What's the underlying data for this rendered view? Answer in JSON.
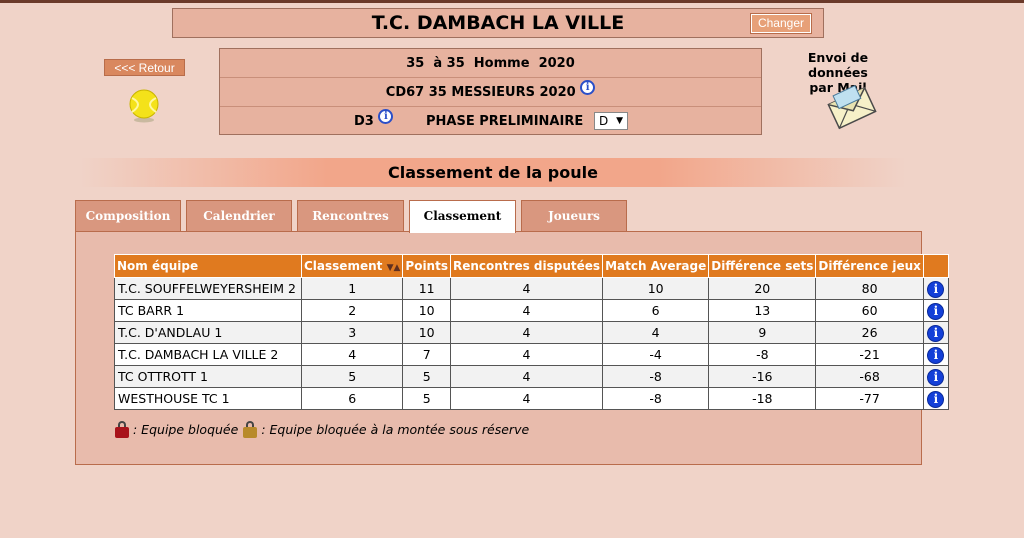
{
  "header": {
    "title": "T.C. DAMBACH LA VILLE",
    "change_label": "Changer",
    "back_label": "<<< Retour"
  },
  "info": {
    "row1": "35  à 35  Homme  2020",
    "row2": "CD67 35 MESSIEURS 2020",
    "division": "D3",
    "phase": "PHASE PRELIMINAIRE",
    "select_value": "D"
  },
  "mail": {
    "label_line1": "Envoi de données",
    "label_line2": "par Mail"
  },
  "section_title": "Classement de la poule",
  "tabs": [
    {
      "label": "Composition",
      "active": false
    },
    {
      "label": "Calendrier",
      "active": false
    },
    {
      "label": "Rencontres",
      "active": false
    },
    {
      "label": "Classement",
      "active": true
    },
    {
      "label": "Joueurs",
      "active": false
    }
  ],
  "table": {
    "columns": [
      "Nom équipe",
      "Classement",
      "Points",
      "Rencontres disputées",
      "Match Average",
      "Différence sets",
      "Différence jeux"
    ],
    "sort_arrows": "▼▲",
    "rows": [
      [
        "T.C. SOUFFELWEYERSHEIM 2",
        "1",
        "11",
        "4",
        "10",
        "20",
        "80"
      ],
      [
        "TC BARR 1",
        "2",
        "10",
        "4",
        "6",
        "13",
        "60"
      ],
      [
        "T.C. D'ANDLAU 1",
        "3",
        "10",
        "4",
        "4",
        "9",
        "26"
      ],
      [
        "T.C. DAMBACH LA VILLE 2",
        "4",
        "7",
        "4",
        "-4",
        "-8",
        "-21"
      ],
      [
        "TC OTTROTT 1",
        "5",
        "5",
        "4",
        "-8",
        "-16",
        "-68"
      ],
      [
        "WESTHOUSE TC 1",
        "6",
        "5",
        "4",
        "-8",
        "-18",
        "-77"
      ]
    ]
  },
  "legend": {
    "blocked": ": Equipe bloquée",
    "blocked_promotion": ": Equipe bloquée à la montée sous réserve"
  },
  "colors": {
    "background": "#f0d3c8",
    "header_orange": "#e07a1f",
    "info_blue": "#1440d8"
  }
}
